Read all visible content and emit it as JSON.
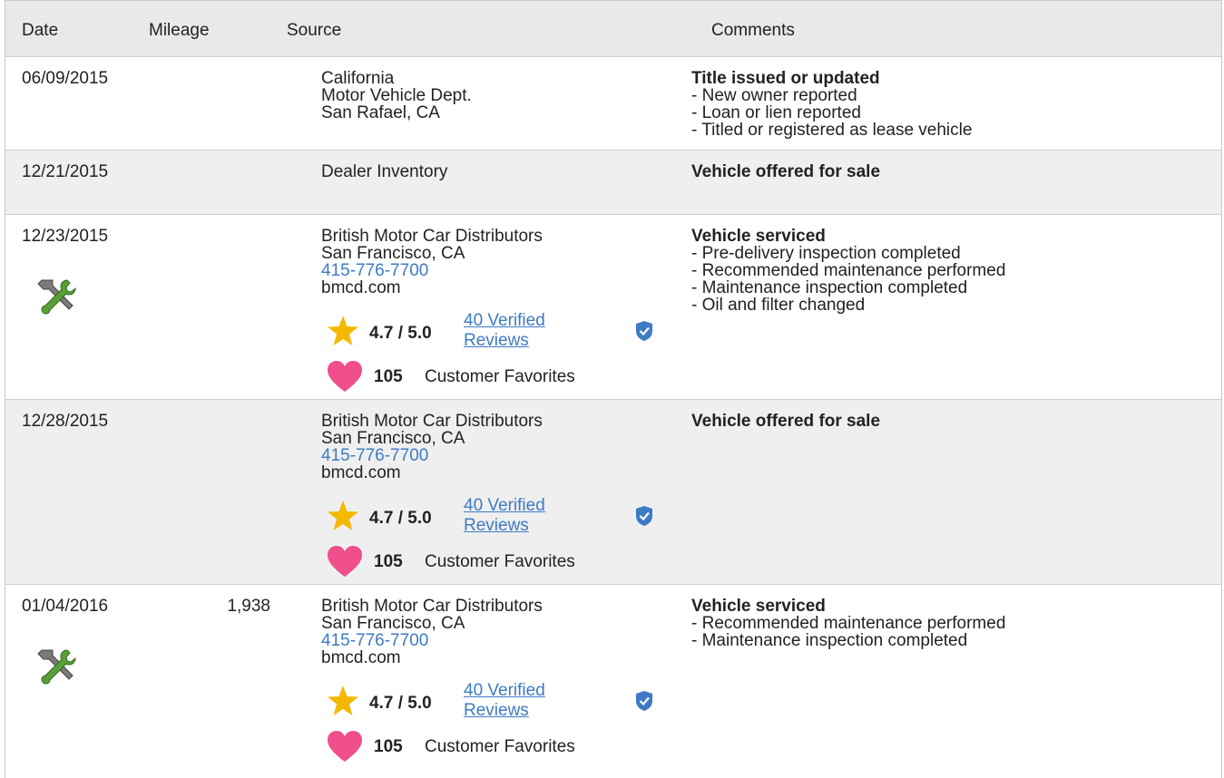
{
  "headers": {
    "date": "Date",
    "mileage": "Mileage",
    "source": "Source",
    "comments": "Comments"
  },
  "colors": {
    "link": "#3d7bc4",
    "star": "#f5b800",
    "heart": "#ef4f8b",
    "shield": "#3d7bc4",
    "wrench": "#5aa03a"
  },
  "icons": {
    "service": "wrench-screwdriver-icon",
    "rating": "star-icon",
    "verified": "shield-check-icon",
    "favorite": "heart-icon"
  },
  "rows": [
    {
      "date": "06/09/2015",
      "mileage": "",
      "source": [
        "California",
        "Motor Vehicle Dept.",
        "San Rafael, CA"
      ],
      "comment_title": "Title issued or updated",
      "comment_items": [
        "- New owner reported",
        "- Loan or lien reported",
        "- Titled or registered as lease vehicle"
      ]
    },
    {
      "date": "12/21/2015",
      "mileage": "",
      "source": [
        "Dealer Inventory"
      ],
      "comment_title": "Vehicle offered for sale",
      "comment_items": []
    },
    {
      "date": "12/23/2015",
      "mileage": "",
      "source": [
        "British Motor Car Distributors",
        "San Francisco, CA"
      ],
      "phone": "415-776-7700",
      "website": "bmcd.com",
      "rating": "4.7 / 5.0",
      "reviews_line1": "40 Verified",
      "reviews_line2": "Reviews",
      "favorites_count": "105",
      "favorites_label": "Customer Favorites",
      "comment_title": "Vehicle serviced",
      "comment_items": [
        "- Pre-delivery inspection completed",
        "- Recommended maintenance performed",
        "- Maintenance inspection completed",
        "- Oil and filter changed"
      ]
    },
    {
      "date": "12/28/2015",
      "mileage": "",
      "source": [
        "British Motor Car Distributors",
        "San Francisco, CA"
      ],
      "phone": "415-776-7700",
      "website": "bmcd.com",
      "rating": "4.7 / 5.0",
      "reviews_line1": "40 Verified",
      "reviews_line2": "Reviews",
      "favorites_count": "105",
      "favorites_label": "Customer Favorites",
      "comment_title": "Vehicle offered for sale",
      "comment_items": []
    },
    {
      "date": "01/04/2016",
      "mileage": "1,938",
      "source": [
        "British Motor Car Distributors",
        "San Francisco, CA"
      ],
      "phone": "415-776-7700",
      "website": "bmcd.com",
      "rating": "4.7 / 5.0",
      "reviews_line1": "40 Verified",
      "reviews_line2": "Reviews",
      "favorites_count": "105",
      "favorites_label": "Customer Favorites",
      "comment_title": "Vehicle serviced",
      "comment_items": [
        "- Recommended maintenance performed",
        "- Maintenance inspection completed"
      ]
    }
  ]
}
